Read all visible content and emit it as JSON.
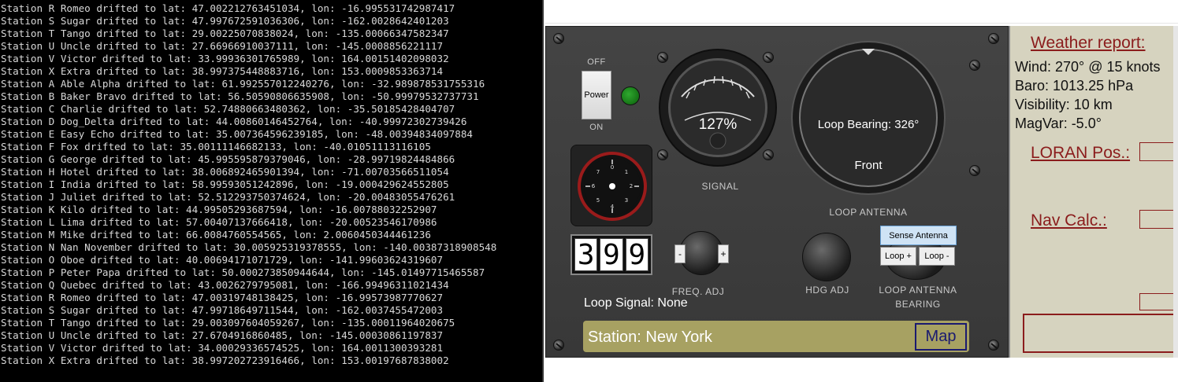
{
  "console": {
    "lines": [
      "Station R Romeo drifted to lat: 47.002212763451034, lon: -16.995531742987417",
      "Station S Sugar drifted to lat: 47.997672591036306, lon: -162.0028642401203",
      "Station T Tango drifted to lat: 29.00225070838024, lon: -135.00066347582347",
      "Station U Uncle drifted to lat: 27.66966910037111, lon: -145.0008856221117",
      "Station V Victor drifted to lat: 33.99936301765989, lon: 164.00151402098032",
      "Station X Extra drifted to lat: 38.997375448883716, lon: 153.0009853363714",
      "Station A Able Alpha drifted to lat: 61.992557012240276, lon: -32.989878531755316",
      "Station B Baker Bravo drifted to lat: 56.50590806635908, lon: -50.99979532737731",
      "Station C Charlie drifted to lat: 52.74880663480362, lon: -35.50185428404707",
      "Station D Dog_Delta drifted to lat: 44.00860146452764, lon: -40.99972302739426",
      "Station E Easy Echo drifted to lat: 35.007364596239185, lon: -48.00394834097884",
      "Station F Fox drifted to lat: 35.00111146682133, lon: -40.01051113116105",
      "Station G George drifted to lat: 45.995595879379046, lon: -28.99719824484866",
      "Station H Hotel drifted to lat: 38.006892465901394, lon: -71.00703566511054",
      "Station I India drifted to lat: 58.99593051242896, lon: -19.000429624552805",
      "Station J Juliet drifted to lat: 52.512293750374624, lon: -20.00483055476261",
      "Station K Kilo drifted to lat: 44.99505293687594, lon: -16.00788032252907",
      "Station L Lima drifted to lat: 57.00407137666418, lon: -20.00523546170986",
      "Station M Mike drifted to lat: 66.0084760554565, lon: 2.0060450344461236",
      "Station N Nan November drifted to lat: 30.005925319378555, lon: -140.00387318908548",
      "Station O Oboe drifted to lat: 40.00694171071729, lon: -141.99603624319607",
      "Station P Peter Papa drifted to lat: 50.000273850944644, lon: -145.01497715465587",
      "Station Q Quebec drifted to lat: 43.0026279795081, lon: -166.99496311021434",
      "Station R Romeo drifted to lat: 47.00319748138425, lon: -16.99573987770627",
      "Station S Sugar drifted to lat: 47.99718649711544, lon: -162.0037455472003",
      "Station T Tango drifted to lat: 29.003097604059267, lon: -135.00011964020675",
      "Station U Uncle drifted to lat: 27.6704916860485, lon: -145.00030861197837",
      "Station V Victor drifted to lat: 34.00029336574525, lon: 164.0011300393281",
      "Station X Extra drifted to lat: 38.997202723916466, lon: 153.00197687838002"
    ]
  },
  "radio": {
    "off_label": "OFF",
    "on_label": "ON",
    "power_label": "Power",
    "signal_value": "127%",
    "signal_label": "SIGNAL",
    "loop_bearing": "Loop Bearing: 326°",
    "loop_front": "Front",
    "loop_antenna_label": "LOOP ANTENNA",
    "counter_digits": [
      "3",
      "9",
      "9"
    ],
    "freq_minus": "-",
    "freq_plus": "+",
    "freq_label": "FREQ. ADJ",
    "hdg_label": "HDG ADJ",
    "sense_label": "Sense Antenna",
    "loop_plus": "Loop +",
    "loop_minus": "Loop -",
    "loop_bearing_label_1": "LOOP ANTENNA",
    "loop_bearing_label_2": "BEARING",
    "loop_signal": "Loop Signal: None",
    "station": "Station: New York",
    "map_button": "Map"
  },
  "info": {
    "weather_title": "Weather report:",
    "wind": "Wind: 270° @ 15 knots",
    "baro": "Baro: 1013.25 hPa",
    "visibility": "Visibility: 10 km",
    "magvar": "MagVar: -5.0°",
    "loran_title": "LORAN Pos.:",
    "nav_title": "Nav Calc.:"
  }
}
